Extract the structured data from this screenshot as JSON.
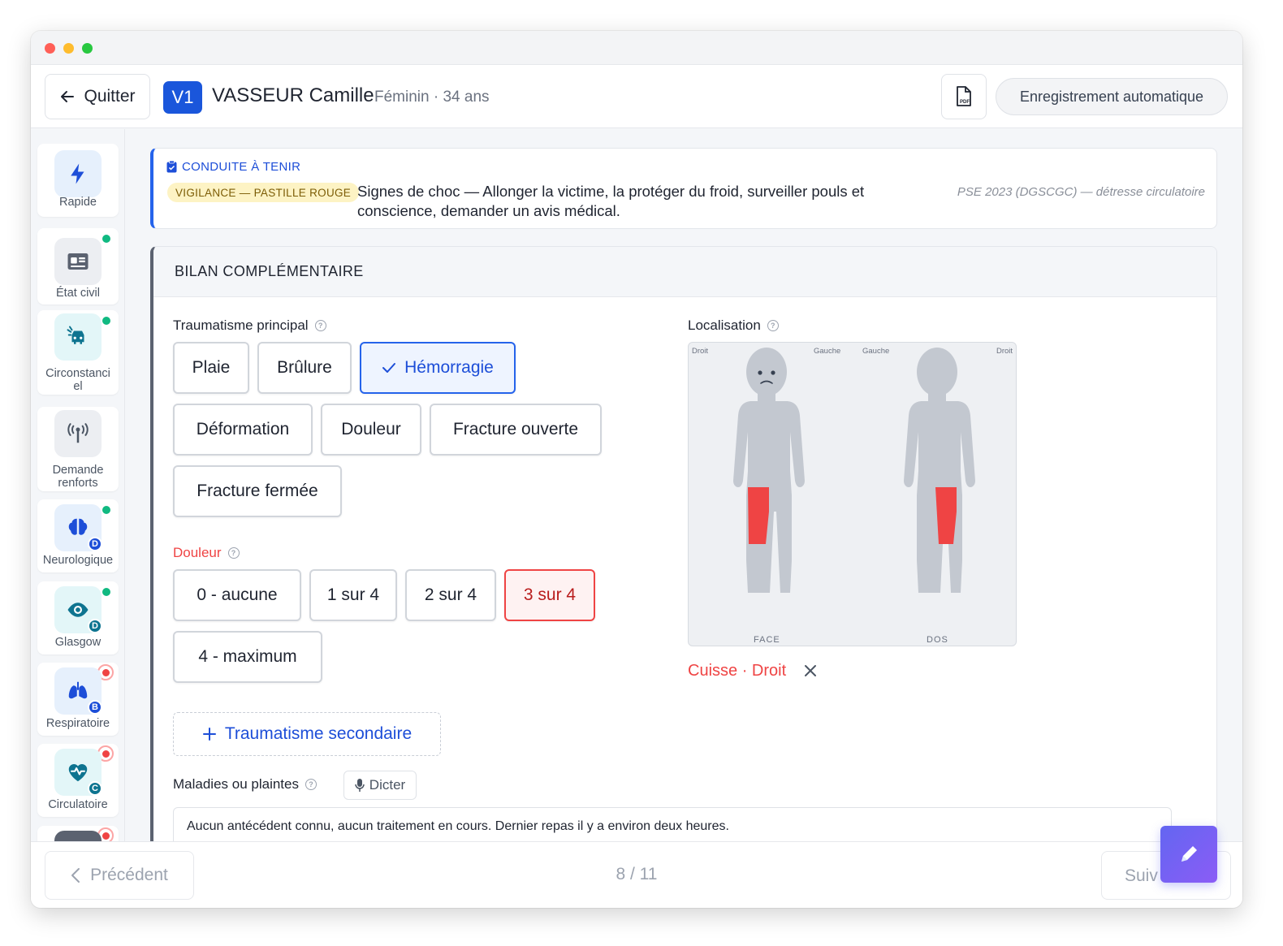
{
  "header": {
    "quit_label": "Quitter",
    "avatar_initials": "V1",
    "patient_name": "VASSEUR Camille",
    "patient_meta": "Féminin · 34 ans",
    "autosave_label": "Enregistrement automatique"
  },
  "sidebar": {
    "items": [
      {
        "label": "Rapide",
        "icon": "lightning-icon",
        "status": "none"
      },
      {
        "label": "État civil",
        "icon": "id-card-icon",
        "status": "done"
      },
      {
        "label": "Circonstanciel",
        "icon": "car-crash-icon",
        "status": "done"
      },
      {
        "label": "Demande renforts",
        "icon": "radio-tower-icon",
        "status": "none"
      },
      {
        "label": "Neurologique",
        "icon": "brain-icon",
        "status": "done",
        "badge": "D"
      },
      {
        "label": "Glasgow",
        "icon": "eye-icon",
        "status": "done",
        "badge": "D"
      },
      {
        "label": "Respiratoire",
        "icon": "lungs-icon",
        "status": "alert",
        "badge": "B"
      },
      {
        "label": "Circulatoire",
        "icon": "heart-pulse-icon",
        "status": "alert",
        "badge": "C"
      }
    ]
  },
  "alert": {
    "title": "CONDUITE À TENIR",
    "tag": "VIGILANCE — PASTILLE ROUGE",
    "text": "Signes de choc — Allonger la victime, la protéger du froid, surveiller pouls et conscience, demander un avis médical.",
    "source": "PSE 2023 (DGSCGC) — détresse circulatoire"
  },
  "bilan": {
    "title": "BILAN COMPLÉMENTAIRE",
    "trauma_label": "Traumatisme principal",
    "trauma_options": [
      "Plaie",
      "Brûlure",
      "Hémorragie",
      "Déformation",
      "Douleur",
      "Fracture ouverte",
      "Fracture fermée"
    ],
    "trauma_selected": "Hémorragie",
    "pain_label": "Douleur",
    "pain_options": [
      "0 - aucune",
      "1 sur 4",
      "2 sur 4",
      "3 sur 4",
      "4 - maximum"
    ],
    "pain_selected": "3 sur 4",
    "secondary_trauma_label": "Traumatisme secondaire",
    "complaints_label": "Maladies ou plaintes",
    "dictate_label": "Dicter",
    "complaints_text": "Aucun antécédent connu, aucun traitement en cours. Dernier repas il y a environ deux heures.",
    "localisation_label": "Localisation",
    "map": {
      "front_right": "Droit",
      "front_left": "Gauche",
      "back_left": "Gauche",
      "back_right": "Droit",
      "front_label": "FACE",
      "back_label": "DOS"
    },
    "location_result": "Cuisse · Droit"
  },
  "footer": {
    "prev_label": "Précédent",
    "page": "8 / 11",
    "next_label": "Suiv"
  },
  "colors": {
    "primary": "#1d4ed8",
    "danger": "#ef4444",
    "success": "#10b981",
    "warning_bg": "#fdf3c4"
  }
}
